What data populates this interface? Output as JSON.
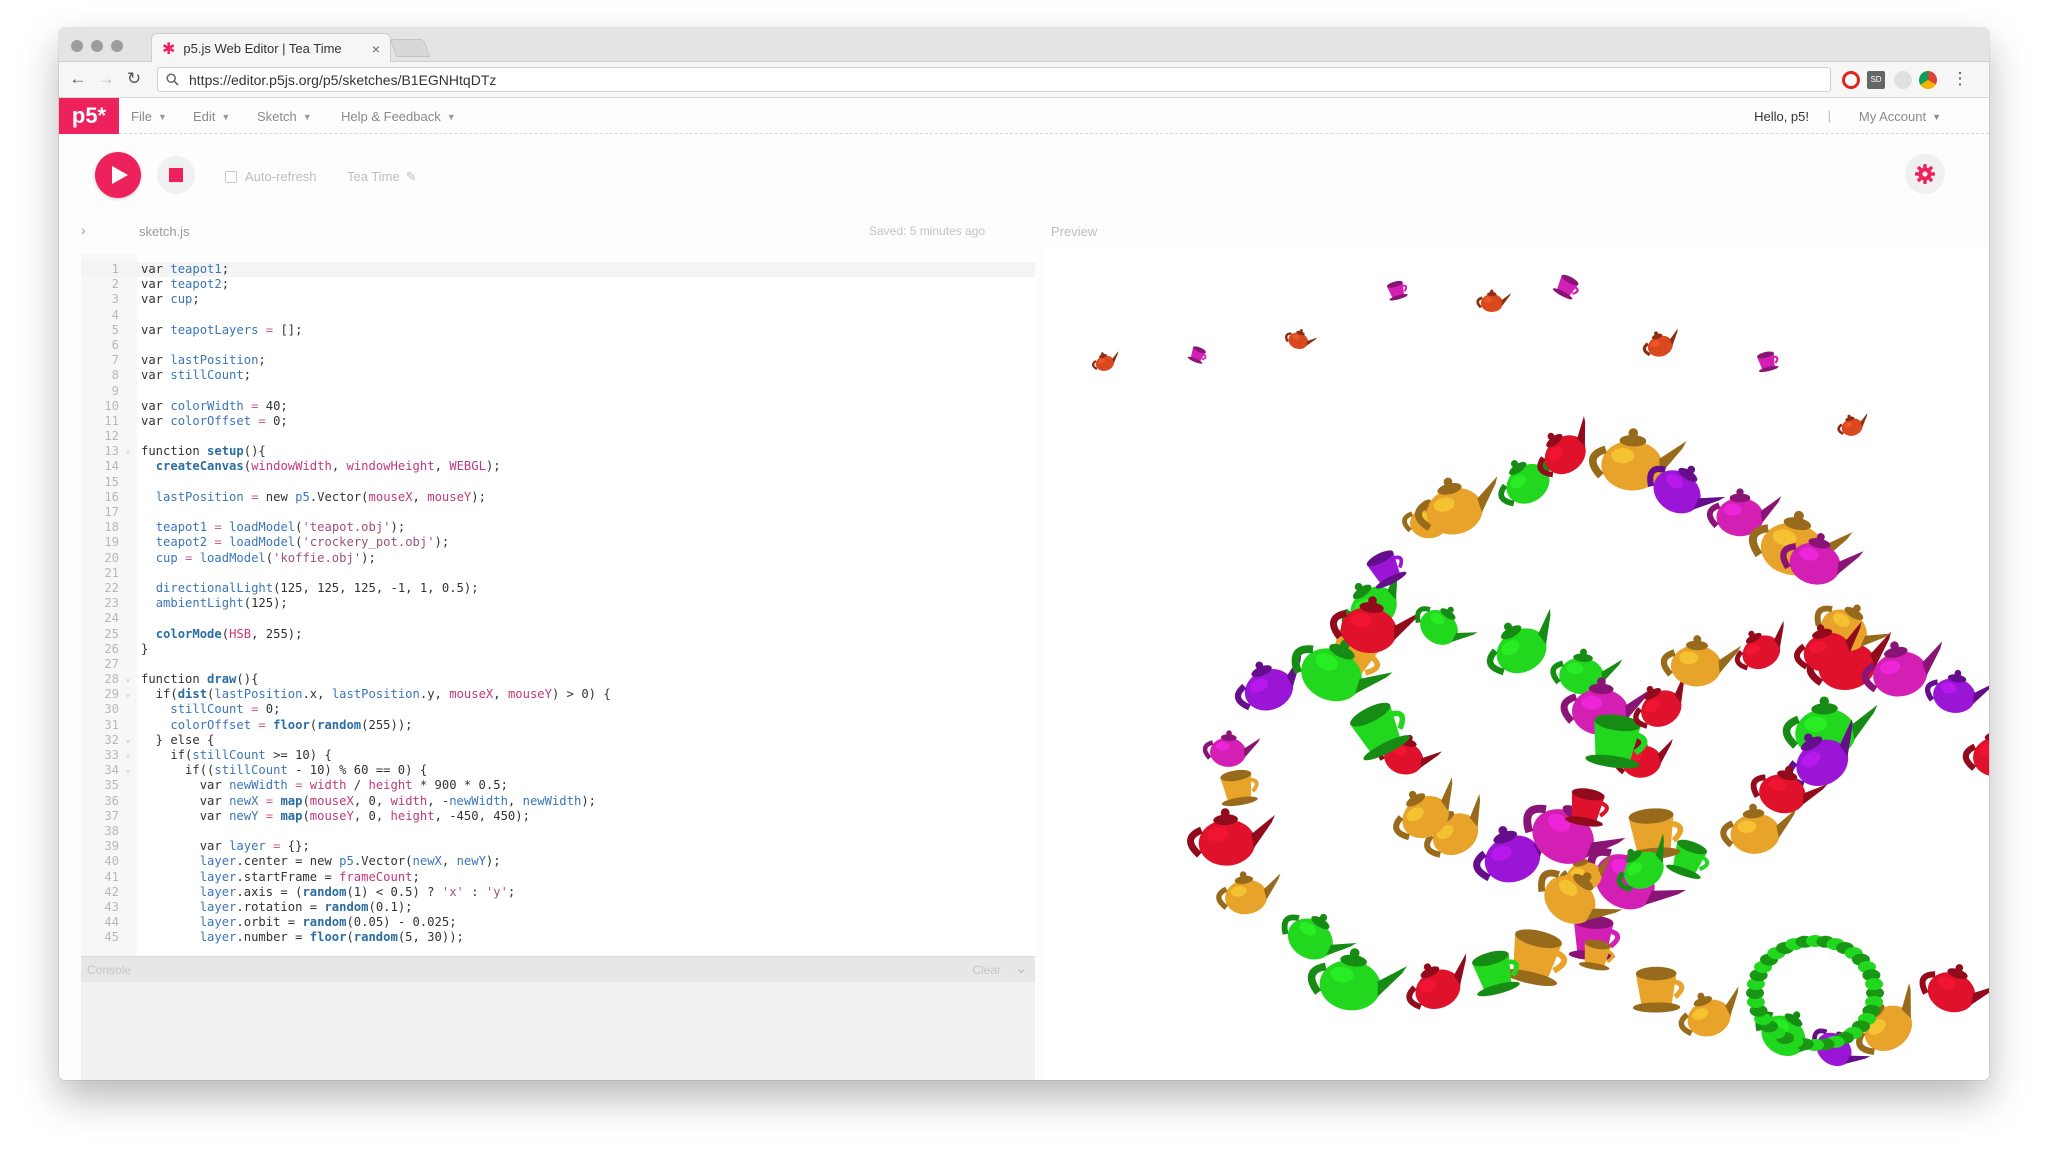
{
  "browser": {
    "tab_title": "p5.js Web Editor | Tea Time",
    "tab_close": "×",
    "url": "https://editor.p5js.org/p5/sketches/B1EGNHtqDTz",
    "back": "←",
    "forward": "→",
    "reload": "↻",
    "extensions": [
      "opera-icon",
      "sd-icon",
      "feather-icon",
      "chrome-icon"
    ],
    "ext_text": "SD",
    "menu": "⋮"
  },
  "app": {
    "logo": "p5*",
    "menus": [
      {
        "label": "File"
      },
      {
        "label": "Edit"
      },
      {
        "label": "Sketch"
      },
      {
        "label": "Help & Feedback"
      }
    ],
    "caret": "▼",
    "greeting": "Hello, p5!",
    "separator": "|",
    "account": "My Account",
    "auto_refresh": "Auto-refresh",
    "project_name": "Tea Time",
    "pencil": "✎",
    "collapse": "›",
    "file_name": "sketch.js",
    "saved_status": "Saved: 5 minutes ago",
    "preview_label": "Preview",
    "console_label": "Console",
    "console_clear": "Clear",
    "console_chevron": "⌄"
  },
  "colors": {
    "accent": "#ed225d",
    "teapot_red": "#e0112b",
    "teapot_green": "#22d81e",
    "teapot_orange": "#e8a42a",
    "teapot_purple": "#9b15d6",
    "teapot_magenta": "#d41fb5"
  },
  "code": {
    "lines": [
      {
        "n": "1",
        "fold": "",
        "t": [
          [
            "kw",
            "var "
          ],
          [
            "v",
            "teapot1"
          ],
          [
            "n",
            ";"
          ]
        ]
      },
      {
        "n": "2",
        "fold": "",
        "t": [
          [
            "kw",
            "var "
          ],
          [
            "v",
            "teapot2"
          ],
          [
            "n",
            ";"
          ]
        ]
      },
      {
        "n": "3",
        "fold": "",
        "t": [
          [
            "kw",
            "var "
          ],
          [
            "v",
            "cup"
          ],
          [
            "n",
            ";"
          ]
        ]
      },
      {
        "n": "4",
        "fold": "",
        "t": []
      },
      {
        "n": "5",
        "fold": "",
        "t": [
          [
            "kw",
            "var "
          ],
          [
            "v",
            "teapotLayers"
          ],
          [
            "op",
            " = "
          ],
          [
            "n",
            "[];"
          ]
        ]
      },
      {
        "n": "6",
        "fold": "",
        "t": []
      },
      {
        "n": "7",
        "fold": "",
        "t": [
          [
            "kw",
            "var "
          ],
          [
            "v",
            "lastPosition"
          ],
          [
            "n",
            ";"
          ]
        ]
      },
      {
        "n": "8",
        "fold": "",
        "t": [
          [
            "kw",
            "var "
          ],
          [
            "v",
            "stillCount"
          ],
          [
            "n",
            ";"
          ]
        ]
      },
      {
        "n": "9",
        "fold": "",
        "t": []
      },
      {
        "n": "10",
        "fold": "",
        "t": [
          [
            "kw",
            "var "
          ],
          [
            "v",
            "colorWidth"
          ],
          [
            "op",
            " = "
          ],
          [
            "n",
            "40;"
          ]
        ]
      },
      {
        "n": "11",
        "fold": "",
        "t": [
          [
            "kw",
            "var "
          ],
          [
            "v",
            "colorOffset"
          ],
          [
            "op",
            " = "
          ],
          [
            "n",
            "0;"
          ]
        ]
      },
      {
        "n": "12",
        "fold": "",
        "t": []
      },
      {
        "n": "13",
        "fold": "⌄",
        "t": [
          [
            "kw",
            "function "
          ],
          [
            "f",
            "setup"
          ],
          [
            "n",
            "(){"
          ]
        ]
      },
      {
        "n": "14",
        "fold": "",
        "t": [
          [
            "n",
            "  "
          ],
          [
            "f",
            "createCanvas"
          ],
          [
            "n",
            "("
          ],
          [
            "c",
            "windowWidth"
          ],
          [
            "n",
            ", "
          ],
          [
            "c",
            "windowHeight"
          ],
          [
            "n",
            ", "
          ],
          [
            "c",
            "WEBGL"
          ],
          [
            "n",
            ");"
          ]
        ]
      },
      {
        "n": "15",
        "fold": "",
        "t": []
      },
      {
        "n": "16",
        "fold": "",
        "t": [
          [
            "n",
            "  "
          ],
          [
            "v",
            "lastPosition"
          ],
          [
            "op",
            " = "
          ],
          [
            "kw",
            "new "
          ],
          [
            "v",
            "p5"
          ],
          [
            "n",
            ".Vector("
          ],
          [
            "c",
            "mouseX"
          ],
          [
            "n",
            ", "
          ],
          [
            "c",
            "mouseY"
          ],
          [
            "n",
            ");"
          ]
        ]
      },
      {
        "n": "17",
        "fold": "",
        "t": []
      },
      {
        "n": "18",
        "fold": "",
        "t": [
          [
            "n",
            "  "
          ],
          [
            "v",
            "teapot1"
          ],
          [
            "op",
            " = "
          ],
          [
            "v",
            "loadModel"
          ],
          [
            "n",
            "("
          ],
          [
            "s",
            "'teapot.obj'"
          ],
          [
            "n",
            ");"
          ]
        ]
      },
      {
        "n": "19",
        "fold": "",
        "t": [
          [
            "n",
            "  "
          ],
          [
            "v",
            "teapot2"
          ],
          [
            "op",
            " = "
          ],
          [
            "v",
            "loadModel"
          ],
          [
            "n",
            "("
          ],
          [
            "s",
            "'crockery_pot.obj'"
          ],
          [
            "n",
            ");"
          ]
        ]
      },
      {
        "n": "20",
        "fold": "",
        "t": [
          [
            "n",
            "  "
          ],
          [
            "v",
            "cup"
          ],
          [
            "op",
            " = "
          ],
          [
            "v",
            "loadModel"
          ],
          [
            "n",
            "("
          ],
          [
            "s",
            "'koffie.obj'"
          ],
          [
            "n",
            ");"
          ]
        ]
      },
      {
        "n": "21",
        "fold": "",
        "t": []
      },
      {
        "n": "22",
        "fold": "",
        "t": [
          [
            "n",
            "  "
          ],
          [
            "v",
            "directionalLight"
          ],
          [
            "n",
            "(125, 125, 125, -1, 1, 0.5);"
          ]
        ]
      },
      {
        "n": "23",
        "fold": "",
        "t": [
          [
            "n",
            "  "
          ],
          [
            "v",
            "ambientLight"
          ],
          [
            "n",
            "(125);"
          ]
        ]
      },
      {
        "n": "24",
        "fold": "",
        "t": []
      },
      {
        "n": "25",
        "fold": "",
        "t": [
          [
            "n",
            "  "
          ],
          [
            "f",
            "colorMode"
          ],
          [
            "n",
            "("
          ],
          [
            "c",
            "HSB"
          ],
          [
            "n",
            ", 255);"
          ]
        ]
      },
      {
        "n": "26",
        "fold": "",
        "t": [
          [
            "n",
            "}"
          ]
        ]
      },
      {
        "n": "27",
        "fold": "",
        "t": []
      },
      {
        "n": "28",
        "fold": "⌄",
        "t": [
          [
            "kw",
            "function "
          ],
          [
            "f",
            "draw"
          ],
          [
            "n",
            "(){"
          ]
        ]
      },
      {
        "n": "29",
        "fold": "⌄",
        "t": [
          [
            "n",
            "  if("
          ],
          [
            "f",
            "dist"
          ],
          [
            "n",
            "("
          ],
          [
            "v",
            "lastPosition"
          ],
          [
            "n",
            ".x, "
          ],
          [
            "v",
            "lastPosition"
          ],
          [
            "n",
            ".y, "
          ],
          [
            "c",
            "mouseX"
          ],
          [
            "n",
            ", "
          ],
          [
            "c",
            "mouseY"
          ],
          [
            "n",
            ") > 0) {"
          ]
        ]
      },
      {
        "n": "30",
        "fold": "",
        "t": [
          [
            "n",
            "    "
          ],
          [
            "v",
            "stillCount"
          ],
          [
            "op",
            " = "
          ],
          [
            "n",
            "0;"
          ]
        ]
      },
      {
        "n": "31",
        "fold": "",
        "t": [
          [
            "n",
            "    "
          ],
          [
            "v",
            "colorOffset"
          ],
          [
            "op",
            " = "
          ],
          [
            "f",
            "floor"
          ],
          [
            "n",
            "("
          ],
          [
            "f",
            "random"
          ],
          [
            "n",
            "(255));"
          ]
        ]
      },
      {
        "n": "32",
        "fold": "⌄",
        "t": [
          [
            "n",
            "  } else {"
          ]
        ]
      },
      {
        "n": "33",
        "fold": "⌄",
        "t": [
          [
            "n",
            "    if("
          ],
          [
            "v",
            "stillCount"
          ],
          [
            "n",
            " >= 10) {"
          ]
        ]
      },
      {
        "n": "34",
        "fold": "⌄",
        "t": [
          [
            "n",
            "      if(("
          ],
          [
            "v",
            "stillCount"
          ],
          [
            "n",
            " - 10) % 60 == 0) {"
          ]
        ]
      },
      {
        "n": "35",
        "fold": "",
        "t": [
          [
            "n",
            "        "
          ],
          [
            "kw",
            "var "
          ],
          [
            "v",
            "newWidth"
          ],
          [
            "op",
            " = "
          ],
          [
            "c",
            "width"
          ],
          [
            "n",
            " / "
          ],
          [
            "c",
            "height"
          ],
          [
            "n",
            " * 900 * 0.5;"
          ]
        ]
      },
      {
        "n": "36",
        "fold": "",
        "t": [
          [
            "n",
            "        "
          ],
          [
            "kw",
            "var "
          ],
          [
            "v",
            "newX"
          ],
          [
            "op",
            " = "
          ],
          [
            "f",
            "map"
          ],
          [
            "n",
            "("
          ],
          [
            "c",
            "mouseX"
          ],
          [
            "n",
            ", 0, "
          ],
          [
            "c",
            "width"
          ],
          [
            "n",
            ", -"
          ],
          [
            "v",
            "newWidth"
          ],
          [
            "n",
            ", "
          ],
          [
            "v",
            "newWidth"
          ],
          [
            "n",
            ");"
          ]
        ]
      },
      {
        "n": "37",
        "fold": "",
        "t": [
          [
            "n",
            "        "
          ],
          [
            "kw",
            "var "
          ],
          [
            "v",
            "newY"
          ],
          [
            "op",
            " = "
          ],
          [
            "f",
            "map"
          ],
          [
            "n",
            "("
          ],
          [
            "c",
            "mouseY"
          ],
          [
            "n",
            ", 0, "
          ],
          [
            "c",
            "height"
          ],
          [
            "n",
            ", -450, 450);"
          ]
        ]
      },
      {
        "n": "38",
        "fold": "",
        "t": []
      },
      {
        "n": "39",
        "fold": "",
        "t": [
          [
            "n",
            "        "
          ],
          [
            "kw",
            "var "
          ],
          [
            "v",
            "layer"
          ],
          [
            "op",
            " = "
          ],
          [
            "n",
            "{};"
          ]
        ]
      },
      {
        "n": "40",
        "fold": "",
        "t": [
          [
            "n",
            "        "
          ],
          [
            "v",
            "layer"
          ],
          [
            "n",
            ".center = "
          ],
          [
            "kw",
            "new "
          ],
          [
            "v",
            "p5"
          ],
          [
            "n",
            ".Vector("
          ],
          [
            "v",
            "newX"
          ],
          [
            "n",
            ", "
          ],
          [
            "v",
            "newY"
          ],
          [
            "n",
            ");"
          ]
        ]
      },
      {
        "n": "41",
        "fold": "",
        "t": [
          [
            "n",
            "        "
          ],
          [
            "v",
            "layer"
          ],
          [
            "n",
            ".startFrame = "
          ],
          [
            "c",
            "frameCount"
          ],
          [
            "n",
            ";"
          ]
        ]
      },
      {
        "n": "42",
        "fold": "",
        "t": [
          [
            "n",
            "        "
          ],
          [
            "v",
            "layer"
          ],
          [
            "n",
            ".axis = ("
          ],
          [
            "f",
            "random"
          ],
          [
            "n",
            "(1) < 0.5) ? "
          ],
          [
            "s",
            "'x'"
          ],
          [
            "n",
            " : "
          ],
          [
            "s",
            "'y'"
          ],
          [
            "n",
            ";"
          ]
        ]
      },
      {
        "n": "43",
        "fold": "",
        "t": [
          [
            "n",
            "        "
          ],
          [
            "v",
            "layer"
          ],
          [
            "n",
            ".rotation = "
          ],
          [
            "f",
            "random"
          ],
          [
            "n",
            "(0.1);"
          ]
        ]
      },
      {
        "n": "44",
        "fold": "",
        "t": [
          [
            "n",
            "        "
          ],
          [
            "v",
            "layer"
          ],
          [
            "n",
            ".orbit = "
          ],
          [
            "f",
            "random"
          ],
          [
            "n",
            "(0.05) - 0.025;"
          ]
        ]
      },
      {
        "n": "45",
        "fold": "",
        "t": [
          [
            "n",
            "        "
          ],
          [
            "v",
            "layer"
          ],
          [
            "n",
            ".number = "
          ],
          [
            "f",
            "floor"
          ],
          [
            "n",
            "("
          ],
          [
            "f",
            "random"
          ],
          [
            "n",
            "(5, 30));"
          ]
        ]
      }
    ]
  }
}
